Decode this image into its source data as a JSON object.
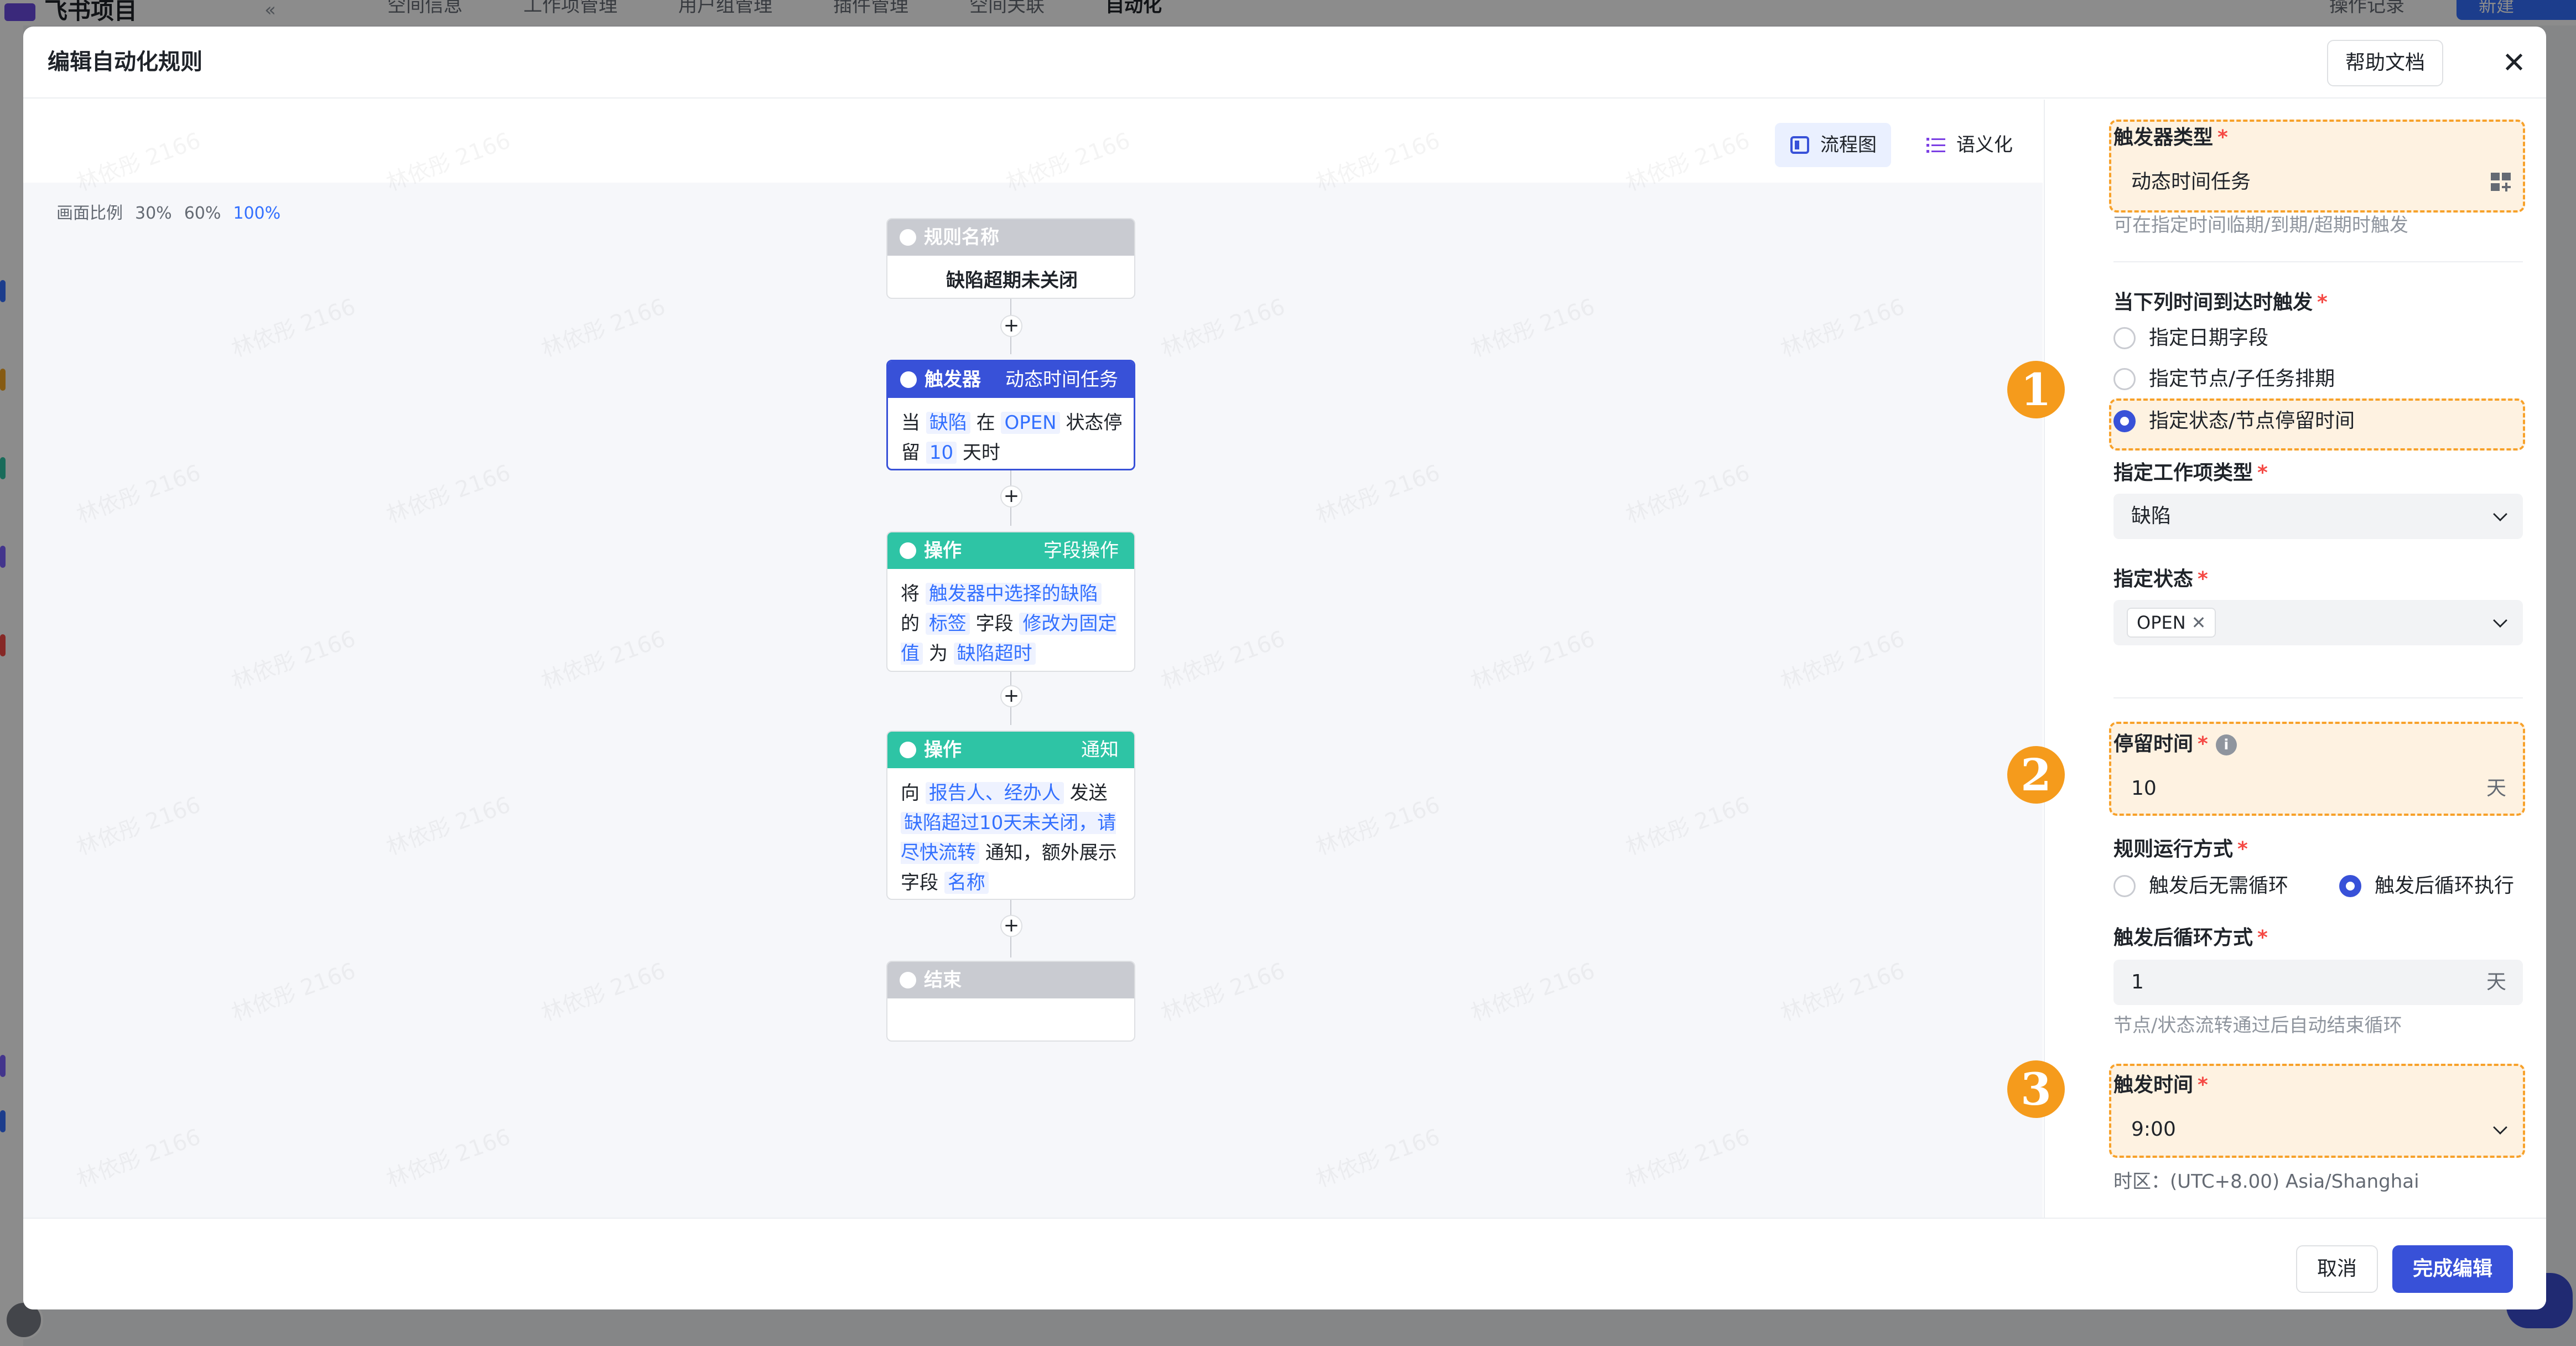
{
  "background": {
    "app_name": "飞书项目",
    "collapse_glyph": "«",
    "tabs": [
      "空间信息",
      "工作项管理",
      "用户组管理",
      "插件管理",
      "空间关联",
      "自动化"
    ],
    "op_log": "操作记录",
    "new_label": "新建"
  },
  "modal": {
    "title": "编辑自动化规则",
    "help": "帮助文档",
    "close_glyph": "✕"
  },
  "canvas": {
    "views": {
      "flow": "流程图",
      "semantic": "语义化"
    },
    "ratio": {
      "label": "画面比例",
      "options": [
        "30%",
        "60%",
        "100%"
      ],
      "current": "100%"
    },
    "watermark": "林依彤 2166"
  },
  "flow": {
    "rule_name": {
      "title": "规则名称",
      "value": "缺陷超期未关闭"
    },
    "trigger": {
      "title": "触发器",
      "type": "动态时间任务",
      "t1": "当",
      "workitem": "缺陷",
      "t2": "在",
      "state": "OPEN",
      "t3": "状态停留",
      "days": "10",
      "t4": "天时"
    },
    "action1": {
      "title": "操作",
      "type": "字段操作",
      "t1": "将",
      "target": "触发器中选择的缺陷",
      "t2": "的",
      "field": "标签",
      "t3": "字段",
      "op": "修改为固定值",
      "t4": "为",
      "value": "缺陷超时"
    },
    "action2": {
      "title": "操作",
      "type": "通知",
      "t1": "向",
      "recipients": "报告人、经办人",
      "t2": "发送",
      "message": "缺陷超过10天未关闭，请尽快流转",
      "t3": "通知，额外展示字段",
      "extra_field": "名称"
    },
    "end": {
      "title": "结束"
    },
    "plus": "+"
  },
  "panel": {
    "trigger_type": {
      "label": "触发器类型",
      "value": "动态时间任务",
      "hint": "可在指定时间临期/到期/超期时触发"
    },
    "when_label": "当下列时间到达时触发",
    "when_options": [
      "指定日期字段",
      "指定节点/子任务排期",
      "指定状态/节点停留时间"
    ],
    "when_selected": 2,
    "workitem_type": {
      "label": "指定工作项类型",
      "value": "缺陷"
    },
    "state": {
      "label": "指定状态",
      "tag": "OPEN",
      "tag_remove": "✕"
    },
    "stay_time": {
      "label": "停留时间",
      "info": "i",
      "value": "10",
      "unit": "天"
    },
    "run_mode": {
      "label": "规则运行方式",
      "options": [
        "触发后无需循环",
        "触发后循环执行"
      ],
      "selected": 1
    },
    "loop_mode": {
      "label": "触发后循环方式",
      "value": "1",
      "unit": "天",
      "hint": "节点/状态流转通过后自动结束循环"
    },
    "trigger_time": {
      "label": "触发时间",
      "value": "9:00",
      "timezone": "时区：(UTC+8.00) Asia/Shanghai"
    },
    "required_mark": "*",
    "badges": [
      "1",
      "2",
      "3"
    ]
  },
  "footer": {
    "cancel": "取消",
    "done": "完成编辑"
  },
  "colors": {
    "accent": "#3851d8",
    "highlight": "#f7a12a",
    "trigger_head": "#3851d8",
    "action_head": "#2ec4a5"
  }
}
